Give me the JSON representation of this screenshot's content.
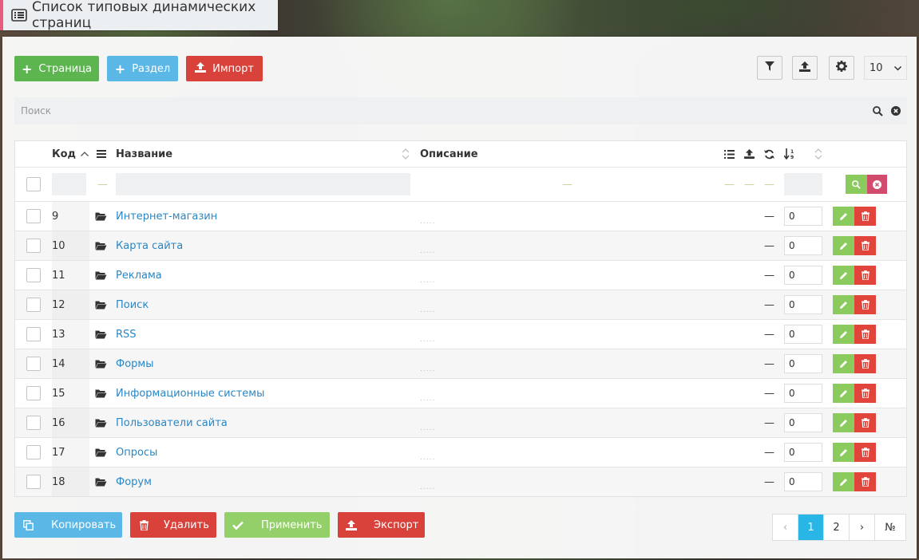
{
  "title": "Список типовых динамических страниц",
  "toolbar": {
    "page_label": "Страница",
    "section_label": "Раздел",
    "import_label": "Импорт",
    "per_page": "10"
  },
  "search": {
    "placeholder": "Поиск"
  },
  "table": {
    "headers": {
      "code": "Код",
      "name": "Название",
      "description": "Описание"
    },
    "rows": [
      {
        "code": "9",
        "name": "Интернет-магазин",
        "value": "0"
      },
      {
        "code": "10",
        "name": "Карта сайта",
        "value": "0"
      },
      {
        "code": "11",
        "name": "Реклама",
        "value": "0"
      },
      {
        "code": "12",
        "name": "Поиск",
        "value": "0"
      },
      {
        "code": "13",
        "name": "RSS",
        "value": "0"
      },
      {
        "code": "14",
        "name": "Формы",
        "value": "0"
      },
      {
        "code": "15",
        "name": "Информационные системы",
        "value": "0"
      },
      {
        "code": "16",
        "name": "Пользователи сайта",
        "value": "0"
      },
      {
        "code": "17",
        "name": "Опросы",
        "value": "0"
      },
      {
        "code": "18",
        "name": "Форум",
        "value": "0"
      }
    ],
    "dash": "—",
    "dots": "....."
  },
  "actions": {
    "copy_label": "Копировать",
    "delete_label": "Удалить",
    "apply_label": "Применить",
    "export_label": "Экспорт"
  },
  "pagination": {
    "prev": "‹",
    "pages": [
      "1",
      "2"
    ],
    "next": "›",
    "goto": "№",
    "current": "1"
  },
  "colors": {
    "green": "#5cb54e",
    "blue": "#5bb8e6",
    "red": "#d9423a",
    "link": "#2a86c4",
    "active_page": "#29b6e6"
  }
}
